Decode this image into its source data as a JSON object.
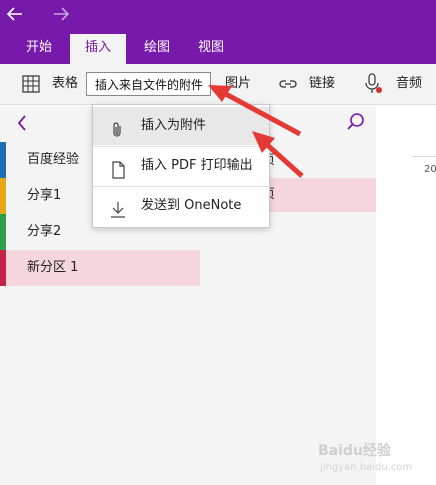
{
  "titlebar": {
    "back_icon": "back-arrow-icon",
    "forward_icon": "forward-arrow-icon"
  },
  "menu": {
    "tabs": [
      {
        "label": "开始",
        "active": false
      },
      {
        "label": "插入",
        "active": true
      },
      {
        "label": "绘图",
        "active": false
      },
      {
        "label": "视图",
        "active": false
      }
    ]
  },
  "ribbon": {
    "table_label": "表格",
    "insert_file_label": "插入来自文件的附件",
    "picture_label": "图片",
    "link_label": "链接",
    "audio_label": "音频"
  },
  "dropdown": {
    "items": [
      {
        "label": "插入为附件",
        "icon": "paperclip-icon"
      },
      {
        "label": "插入 PDF 打印输出",
        "icon": "document-icon"
      },
      {
        "label": "发送到 OneNote",
        "icon": "download-icon"
      }
    ]
  },
  "sections": [
    {
      "label": "百度经验",
      "color": "#1f6fb5"
    },
    {
      "label": "分享1",
      "color": "#e6a817"
    },
    {
      "label": "分享2",
      "color": "#2c9e4b"
    },
    {
      "label": "新分区 1",
      "color": "#c4244a"
    }
  ],
  "pages": {
    "items": [
      "页",
      "页"
    ]
  },
  "right": {
    "date_fragment": "20"
  },
  "watermark": {
    "text": "Baidu经验",
    "sub": "jingyan.baidu.com"
  },
  "colors": {
    "accent": "#7719aa",
    "selected_bg": "#f4d6dc",
    "arrow": "#e53935"
  }
}
